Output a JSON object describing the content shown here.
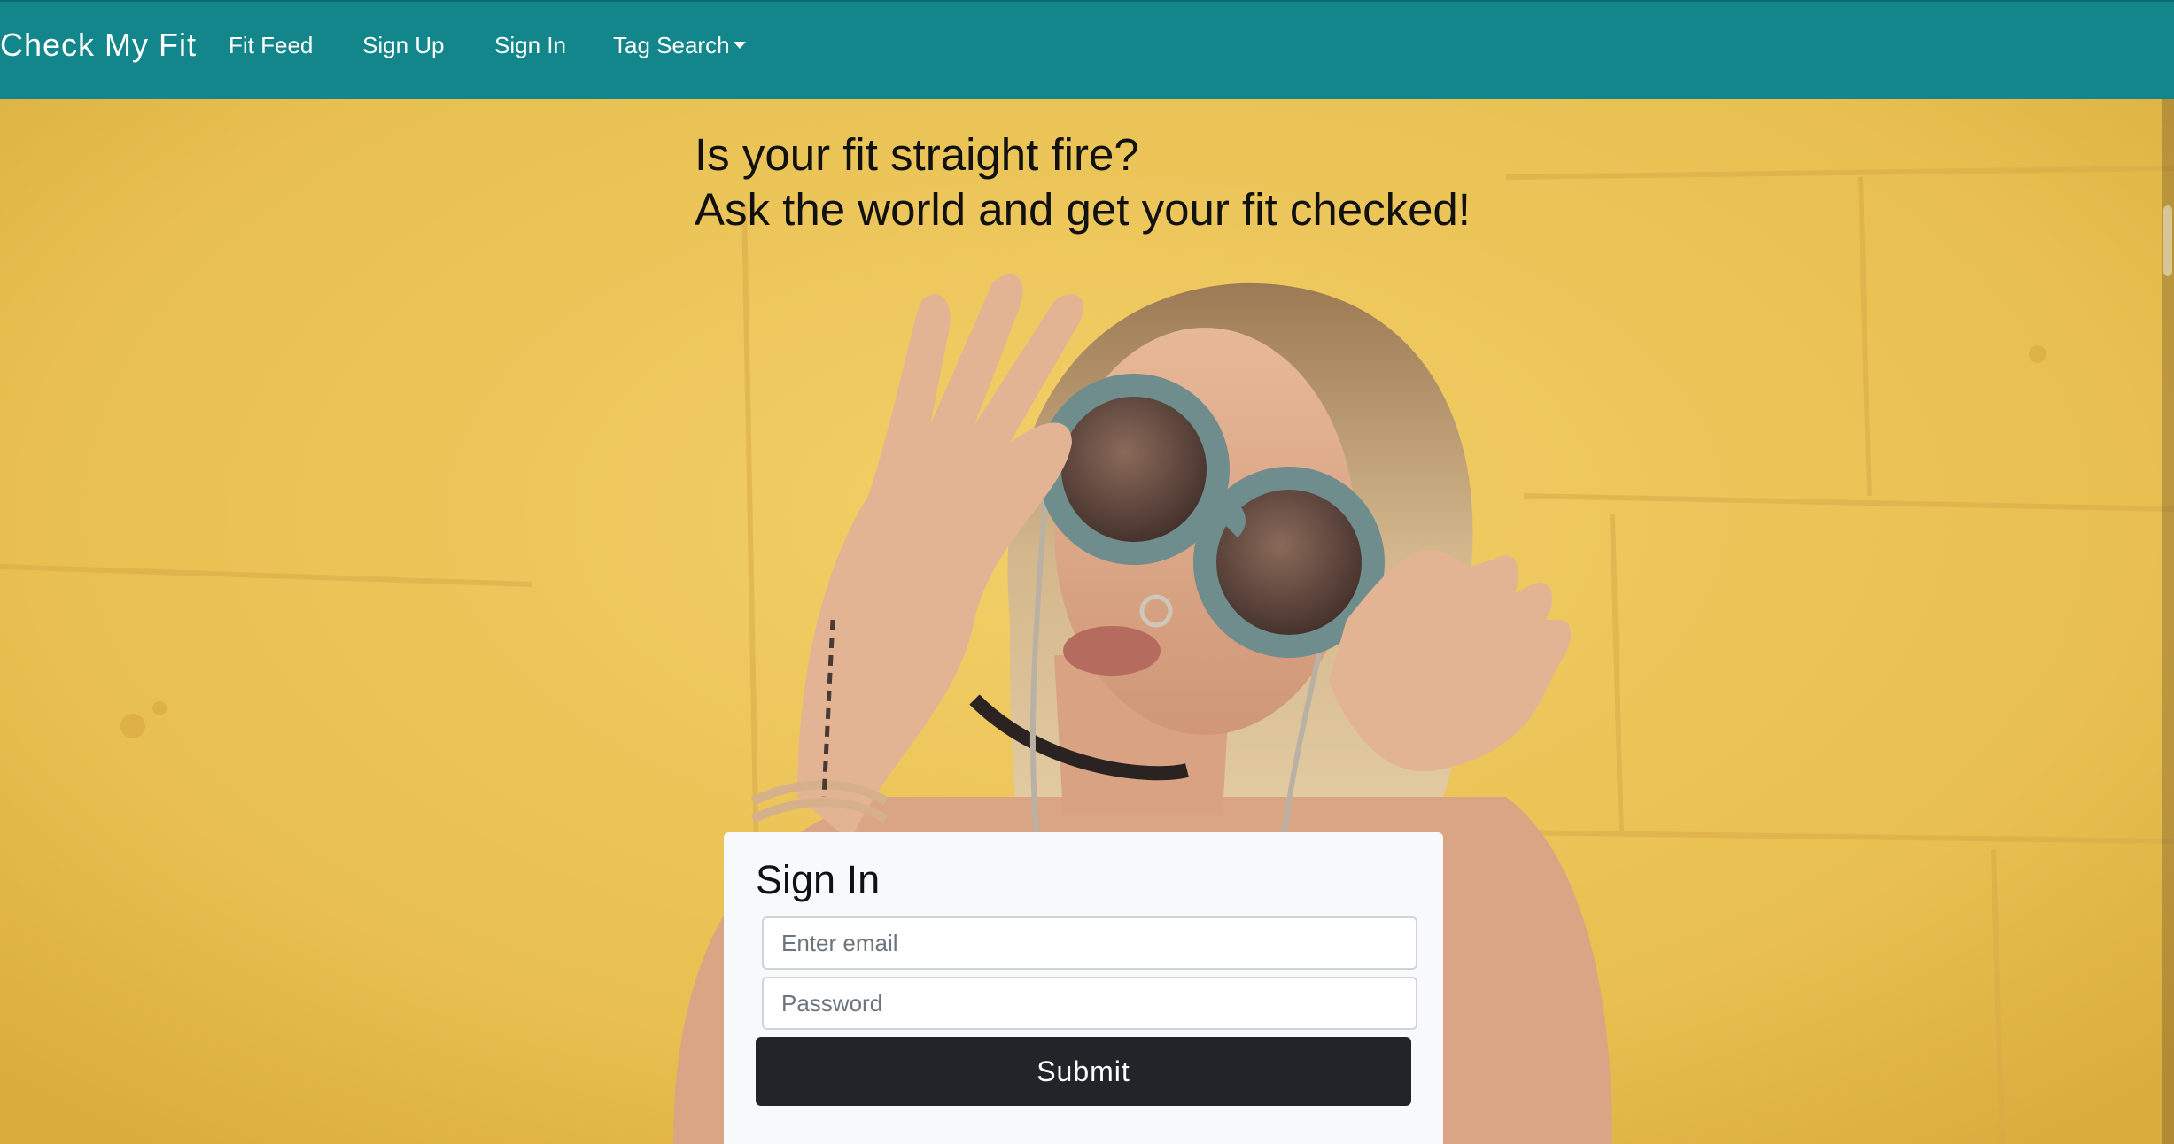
{
  "nav": {
    "brand": "Check My Fit",
    "links": [
      "Fit Feed",
      "Sign Up",
      "Sign In"
    ],
    "dropdown_label": "Tag Search"
  },
  "hero": {
    "line1": "Is your fit straight fire?",
    "line2": "Ask the world and get your fit checked!"
  },
  "signin": {
    "title": "Sign In",
    "email_placeholder": "Enter email",
    "password_placeholder": "Password",
    "submit_label": "Submit"
  },
  "colors": {
    "navbar": "#12868a",
    "background": "#e9c254",
    "button": "#212529",
    "card": "#f8f9fa"
  }
}
